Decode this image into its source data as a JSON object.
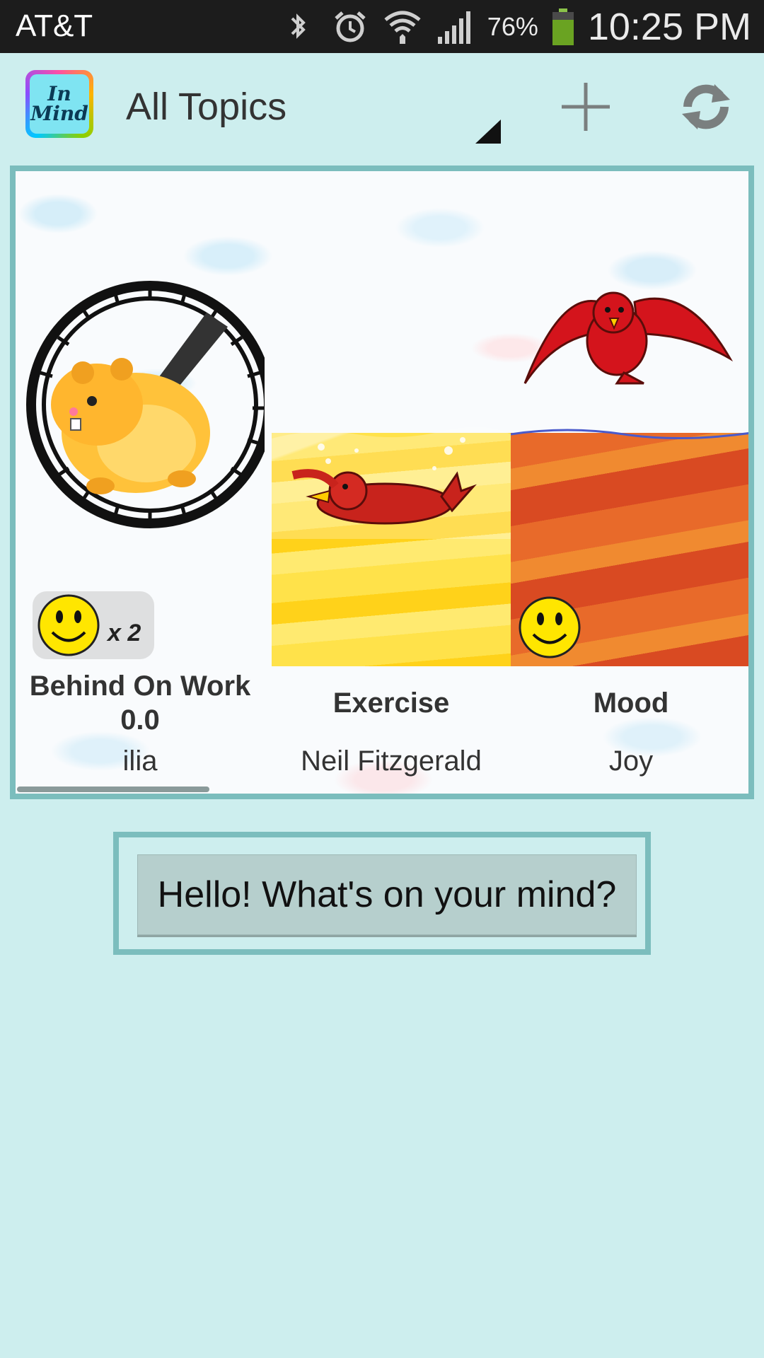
{
  "status_bar": {
    "carrier": "AT&T",
    "battery_percent": "76%",
    "time": "10:25 PM",
    "icons": [
      "bluetooth-icon",
      "alarm-icon",
      "wifi-icon",
      "signal-icon",
      "battery-icon"
    ]
  },
  "action_bar": {
    "logo_text_line1": "In",
    "logo_text_line2": "Mind",
    "title": "All Topics",
    "icons": [
      "dropdown-triangle-icon",
      "plus-icon",
      "refresh-icon"
    ]
  },
  "topics": [
    {
      "name": "Behind On Work",
      "score": "0.0",
      "author": "ilia",
      "mood_multiplier": "x 2",
      "art": "hamster-wheel"
    },
    {
      "name": "Exercise",
      "author": "Neil Fitzgerald",
      "art": "bird-swimming-yellow-water"
    },
    {
      "name": "Mood",
      "author": "Joy",
      "art": "bird-flying-over-red-water"
    }
  ],
  "prompt": {
    "label": "Hello! What's on your mind?"
  },
  "colors": {
    "background": "#cdeeee",
    "panel_border": "#7bbdbd",
    "button": "#b6cfcd",
    "status_bar": "#1c1c1c"
  }
}
